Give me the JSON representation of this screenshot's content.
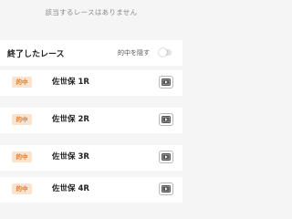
{
  "empty_message": "該当するレースはありません",
  "finished_section": {
    "title": "終了したレース",
    "hide_hits_label": "的中を隠す",
    "hide_hits_toggle_on": false
  },
  "races": [
    {
      "badge": "的中",
      "name": "佐世保 1R",
      "action_icon": "video-replay-icon"
    },
    {
      "badge": "的中",
      "name": "佐世保 2R",
      "action_icon": "video-replay-icon"
    },
    {
      "badge": "的中",
      "name": "佐世保 3R",
      "action_icon": "video-replay-icon"
    },
    {
      "badge": "的中",
      "name": "佐世保 4R",
      "action_icon": "video-replay-icon"
    }
  ],
  "colors": {
    "badge_bg": "#fde3cc",
    "badge_text": "#e07a25",
    "page_bg": "#f5f5f5"
  }
}
